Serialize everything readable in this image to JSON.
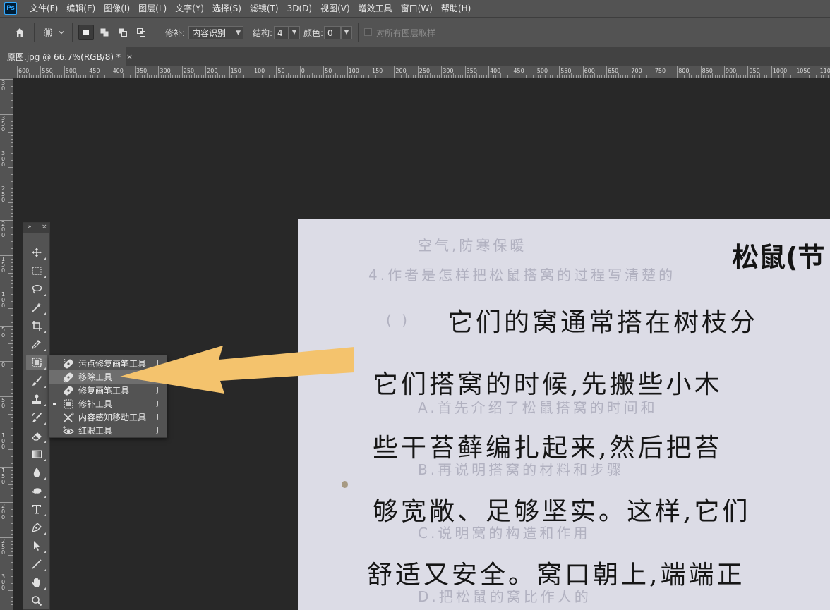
{
  "app": {
    "logo_text": "Ps"
  },
  "menubar": {
    "items": [
      "文件(F)",
      "编辑(E)",
      "图像(I)",
      "图层(L)",
      "文字(Y)",
      "选择(S)",
      "滤镜(T)",
      "3D(D)",
      "视图(V)",
      "增效工具",
      "窗口(W)",
      "帮助(H)"
    ]
  },
  "options": {
    "patch_label": "修补:",
    "patch_value": "内容识别",
    "structure_label": "结构:",
    "structure_value": "4",
    "color_label": "颜色:",
    "color_value": "0",
    "sample_all_label": "对所有图层取样"
  },
  "tab": {
    "title": "原图.jpg @ 66.7%(RGB/8) *",
    "close": "×"
  },
  "ruler_top": {
    "labels": [
      "600",
      "550",
      "500",
      "450",
      "400",
      "350",
      "300",
      "250",
      "200",
      "150",
      "100",
      "50",
      "0",
      "50",
      "100",
      "150",
      "200",
      "250",
      "300",
      "350",
      "400",
      "450",
      "500",
      "550",
      "600",
      "650",
      "700",
      "750",
      "800",
      "850",
      "900",
      "950",
      "1000",
      "1050",
      "1100"
    ]
  },
  "ruler_left": {
    "labels": [
      "3 0",
      "3 5 0",
      "3 0 0",
      "2 5 0",
      "2 0 0",
      "1 5 0",
      "1 0 0",
      "5 0",
      "0",
      "5 0",
      "1 0 0",
      "1 5 0",
      "2 0 0",
      "2 5 0",
      "3 0 0"
    ]
  },
  "flyout": {
    "items": [
      {
        "label": "污点修复画笔工具",
        "key": "J",
        "icon": "spot-healing-brush-icon",
        "active": false,
        "hover": false
      },
      {
        "label": "移除工具",
        "key": "J",
        "icon": "remove-tool-icon",
        "active": false,
        "hover": true
      },
      {
        "label": "修复画笔工具",
        "key": "J",
        "icon": "healing-brush-icon",
        "active": false,
        "hover": false
      },
      {
        "label": "修补工具",
        "key": "J",
        "icon": "patch-tool-icon",
        "active": true,
        "hover": false
      },
      {
        "label": "内容感知移动工具",
        "key": "J",
        "icon": "content-aware-move-icon",
        "active": false,
        "hover": false
      },
      {
        "label": "红眼工具",
        "key": "J",
        "icon": "red-eye-icon",
        "active": false,
        "hover": false
      }
    ]
  },
  "document": {
    "title": "松鼠(节",
    "lines": [
      "它们的窝通常搭在树枝分",
      "它们搭窝的时候,先搬些小木",
      "些干苔藓编扎起来,然后把苔",
      "够宽敞、足够坚实。这样,它们",
      "舒适又安全。窝口朝上,端端正"
    ],
    "ghost_lines": [
      "空气,防寒保暖",
      "4.作者是怎样把松鼠搭窝的过程写清楚的",
      "(  )",
      "A.首先介绍了松鼠搭窝的时间和",
      "B.再说明搭窝的材料和步骤",
      "C.说明窝的构造和作用",
      "D.把松鼠的窝比作人的"
    ]
  },
  "colors": {
    "accent": "#31a8ff",
    "arrow": "#f4c36d",
    "ui_bg": "#535353",
    "canvas_bg": "#282828"
  }
}
